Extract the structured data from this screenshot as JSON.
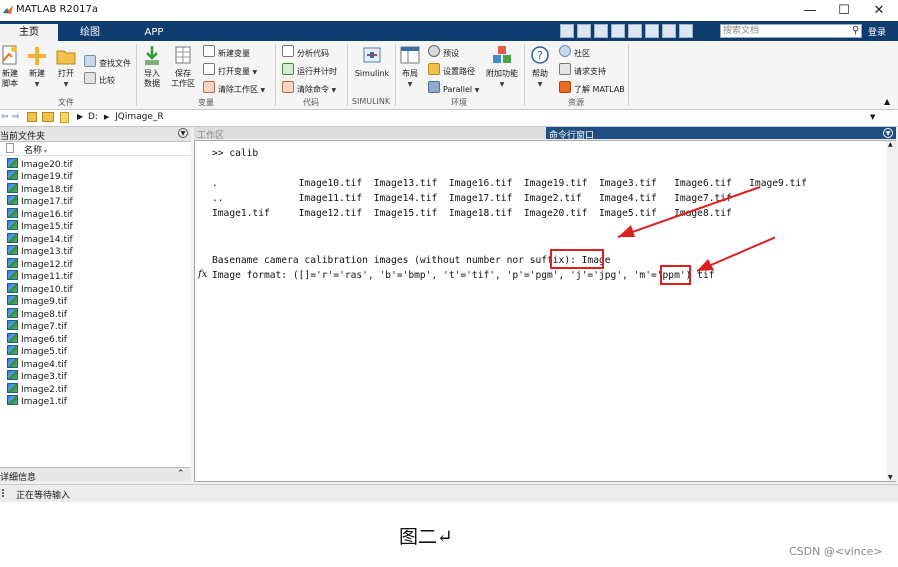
{
  "window": {
    "title": "MATLAB R2017a",
    "controls": [
      "—",
      "☐",
      "✕"
    ]
  },
  "tabs": [
    {
      "label": "主页",
      "active": true
    },
    {
      "label": "绘图",
      "active": false
    },
    {
      "label": "APP",
      "active": false
    }
  ],
  "search": {
    "placeholder": "搜索文档",
    "login_label": "登录"
  },
  "ribbon": {
    "file": {
      "new_script": "新建\n脚本",
      "new": "新建",
      "open": "打开",
      "find_files": "查找文件",
      "compare": "比较",
      "section": "文件"
    },
    "variable": {
      "import": "导入\n数据",
      "save_ws": "保存\n工作区",
      "new_var": "新建变量",
      "open_var": "打开变量",
      "clear_ws": "清除工作区",
      "section": "变量"
    },
    "code": {
      "analyze": "分析代码",
      "run_time": "运行并计时",
      "clear_cmd": "清除命令",
      "section": "代码"
    },
    "simulink": {
      "label": "Simulink",
      "section": "SIMULINK"
    },
    "env": {
      "layout": "布局",
      "prefs": "预设",
      "set_path": "设置路径",
      "parallel": "Parallel",
      "addons": "附加功能",
      "section": "环境"
    },
    "resources": {
      "help": "帮助",
      "community": "社区",
      "request_support": "请求支持",
      "learn": "了解 MATLAB",
      "section": "资源"
    }
  },
  "address": {
    "drive": "D:",
    "folder": "JQimage_R"
  },
  "current_folder": {
    "title": "当前文件夹",
    "column": "名称",
    "files": [
      "Image20.tif",
      "Image19.tif",
      "Image18.tif",
      "Image17.tif",
      "Image16.tif",
      "Image15.tif",
      "Image14.tif",
      "Image13.tif",
      "Image12.tif",
      "Image11.tif",
      "Image10.tif",
      "Image9.tif",
      "Image8.tif",
      "Image7.tif",
      "Image6.tif",
      "Image5.tif",
      "Image4.tif",
      "Image3.tif",
      "Image2.tif",
      "Image1.tif"
    ],
    "details_label": "详细信息"
  },
  "workspace": {
    "title": "工作区"
  },
  "command_window": {
    "title": "命令行窗口",
    "lines": [
      ">> calib",
      ".              Image10.tif  Image13.tif  Image16.tif  Image19.tif  Image3.tif   Image6.tif   Image9.tif",
      "..             Image11.tif  Image14.tif  Image17.tif  Image2.tif   Image4.tif   Image7.tif",
      "Image1.tif     Image12.tif  Image15.tif  Image18.tif  Image20.tif  Image5.tif   Image8.tif",
      "Basename camera calibration images (without number nor suffix): Image",
      "Image format: ([]='r'='ras', 'b'='bmp', 't'='tif', 'p'='pgm', 'j'='jpg', 'm'='ppm') tif"
    ],
    "fx": "fx"
  },
  "status": {
    "text": "正在等待输入"
  },
  "caption": {
    "text": "图二↵"
  },
  "credit": {
    "text": "CSDN @<vince>"
  },
  "colors": {
    "titlebar_blue": "#0f3c6e",
    "annotation_red": "#e02020"
  }
}
